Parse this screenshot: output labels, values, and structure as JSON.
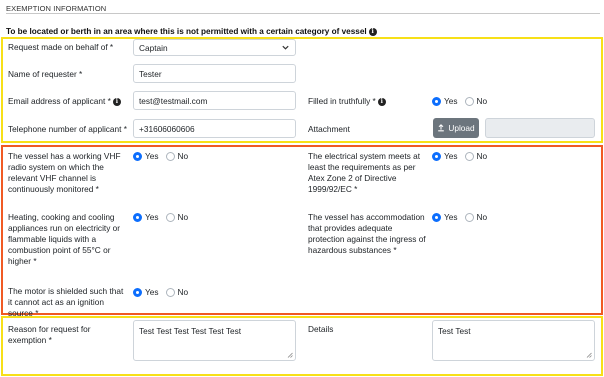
{
  "section": {
    "title": "EXEMPTION INFORMATION",
    "subheading": "To be located or berth in an area where this is not permitted with a certain category of vessel"
  },
  "applicant": {
    "request_on_behalf_label": "Request made on behalf of *",
    "request_on_behalf_value": "Captain",
    "requester_name_label": "Name of requester *",
    "requester_name_value": "Tester",
    "email_label": "Email address of applicant *",
    "email_value": "test@testmail.com",
    "phone_label": "Telephone number of applicant *",
    "phone_value": "+31606060606",
    "filled_truthfully_label": "Filled in truthfully *",
    "filled_truthfully_selected": "Yes",
    "attachment_label": "Attachment",
    "upload_label": "Upload"
  },
  "radio_options": {
    "yes": "Yes",
    "no": "No"
  },
  "vessel_questions": {
    "vhf": {
      "label": "The vessel has a working VHF radio system on which the relevant VHF channel is continuously monitored *",
      "selected": "Yes"
    },
    "electrical": {
      "label": "The electrical system meets at least the requirements as per Atex Zone 2 of Directive 1999/92/EC *",
      "selected": "Yes"
    },
    "heating": {
      "label": "Heating, cooking and cooling appliances run on electricity or flammable liquids with a combustion point of 55°C or higher *",
      "selected": "Yes"
    },
    "accommodation": {
      "label": "The vessel has accommodation that provides adequate protection against the ingress of hazardous substances *",
      "selected": "Yes"
    },
    "motor": {
      "label": "The motor is shielded such that it cannot act as an ignition source *",
      "selected": "Yes"
    }
  },
  "reason": {
    "label": "Reason for request for exemption *",
    "value": "Test Test Test Test Test Test",
    "details_label": "Details",
    "details_value": "Test Test"
  },
  "colors": {
    "highlight_yellow": "#f7e018",
    "highlight_orange": "#f05a24",
    "radio_accent": "#0d6efd",
    "button_gray": "#6c757d"
  },
  "icons": [
    "info-icon",
    "chevron-down-icon",
    "upload-icon",
    "resize-handle-icon"
  ]
}
